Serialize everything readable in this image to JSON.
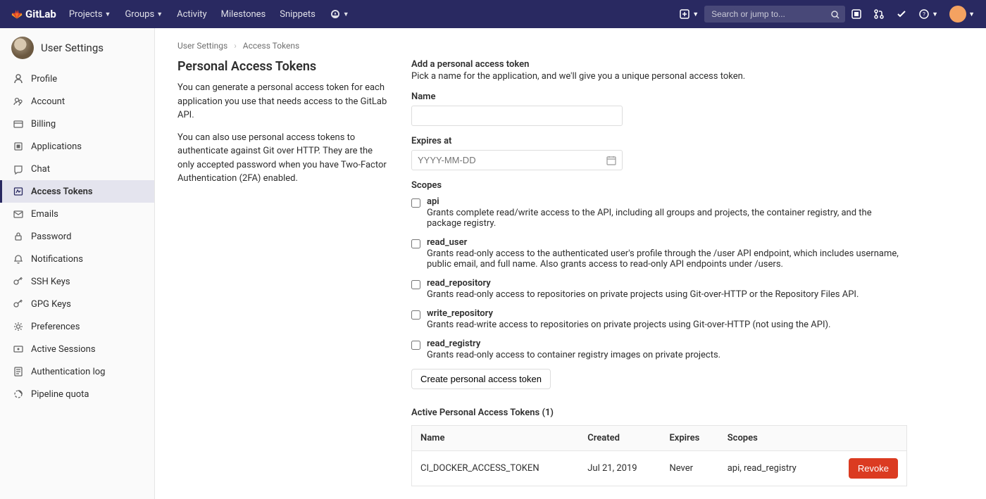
{
  "navbar": {
    "brand": "GitLab",
    "links": [
      "Projects",
      "Groups",
      "Activity",
      "Milestones",
      "Snippets"
    ],
    "search_placeholder": "Search or jump to..."
  },
  "sidebar": {
    "title": "User Settings",
    "items": [
      {
        "label": "Profile"
      },
      {
        "label": "Account"
      },
      {
        "label": "Billing"
      },
      {
        "label": "Applications"
      },
      {
        "label": "Chat"
      },
      {
        "label": "Access Tokens"
      },
      {
        "label": "Emails"
      },
      {
        "label": "Password"
      },
      {
        "label": "Notifications"
      },
      {
        "label": "SSH Keys"
      },
      {
        "label": "GPG Keys"
      },
      {
        "label": "Preferences"
      },
      {
        "label": "Active Sessions"
      },
      {
        "label": "Authentication log"
      },
      {
        "label": "Pipeline quota"
      }
    ],
    "active_index": 5
  },
  "breadcrumb": {
    "root": "User Settings",
    "leaf": "Access Tokens"
  },
  "intro": {
    "heading": "Personal Access Tokens",
    "p1": "You can generate a personal access token for each application you use that needs access to the GitLab API.",
    "p2": "You can also use personal access tokens to authenticate against Git over HTTP. They are the only accepted password when you have Two-Factor Authentication (2FA) enabled."
  },
  "form": {
    "title": "Add a personal access token",
    "sub": "Pick a name for the application, and we'll give you a unique personal access token.",
    "name_label": "Name",
    "name_value": "",
    "expires_label": "Expires at",
    "expires_placeholder": "YYYY-MM-DD",
    "scopes_label": "Scopes",
    "scopes": [
      {
        "name": "api",
        "desc": "Grants complete read/write access to the API, including all groups and projects, the container registry, and the package registry."
      },
      {
        "name": "read_user",
        "desc": "Grants read-only access to the authenticated user's profile through the /user API endpoint, which includes username, public email, and full name. Also grants access to read-only API endpoints under /users."
      },
      {
        "name": "read_repository",
        "desc": "Grants read-only access to repositories on private projects using Git-over-HTTP or the Repository Files API."
      },
      {
        "name": "write_repository",
        "desc": "Grants read-write access to repositories on private projects using Git-over-HTTP (not using the API)."
      },
      {
        "name": "read_registry",
        "desc": "Grants read-only access to container registry images on private projects."
      }
    ],
    "submit": "Create personal access token"
  },
  "tokens": {
    "title": "Active Personal Access Tokens (1)",
    "cols": [
      "Name",
      "Created",
      "Expires",
      "Scopes"
    ],
    "rows": [
      {
        "name": "CI_DOCKER_ACCESS_TOKEN",
        "created": "Jul 21, 2019",
        "expires": "Never",
        "scopes": "api, read_registry"
      }
    ],
    "revoke": "Revoke"
  }
}
